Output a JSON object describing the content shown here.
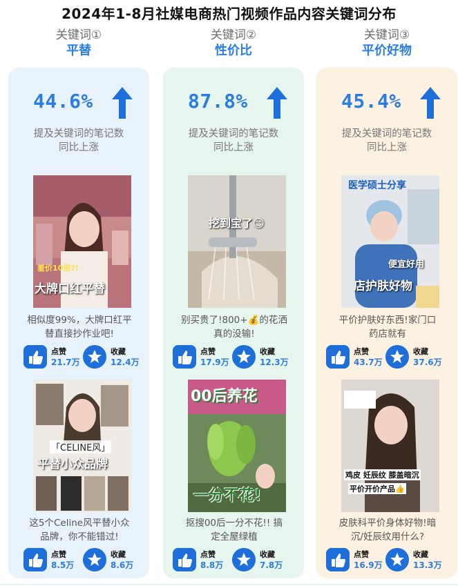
{
  "title": "2024年1-8月社媒电商热门视频作品内容关键词分布",
  "desc_line1": "提及关键词的笔记数",
  "desc_line2": "同比上涨",
  "like_label": "点赞",
  "fav_label": "收藏",
  "columns": [
    {
      "kw_num": "关键词①",
      "kw_name": "平替",
      "pct": "44.6%",
      "posts": [
        {
          "overlay_top": "羞价10倍?!",
          "overlay": "大牌口红平替",
          "caption_1": "相似度99%，大牌口红平",
          "caption_2": "替直接抄作业吧!",
          "likes": "21.7万",
          "favs": "12.4万"
        },
        {
          "overlay_top": "「CELINE风」",
          "overlay": "平替小众品牌",
          "caption_1": "这5个Celine风平替小众",
          "caption_2": "品牌，你不能错过!",
          "likes": "8.5万",
          "favs": "8.6万"
        }
      ]
    },
    {
      "kw_num": "关键词②",
      "kw_name": "性价比",
      "pct": "87.8%",
      "posts": [
        {
          "overlay_top": "",
          "overlay": "挖到宝了😊",
          "caption_1": "别买贵了!800+💰的花洒",
          "caption_2": "真的没输!",
          "likes": "17.9万",
          "favs": "12.3万"
        },
        {
          "overlay_top": "00后养花",
          "overlay": "一分不花!",
          "caption_1": "抠搜00后一分不花!!  搞",
          "caption_2": "定全屋绿植",
          "likes": "8.8万",
          "favs": "7.8万"
        }
      ]
    },
    {
      "kw_num": "关键词③",
      "kw_name": "平价好物",
      "pct": "45.4%",
      "posts": [
        {
          "overlay_top": "医学硕士分享",
          "overlay": "店护肤好物",
          "overlay_mid": "便宜好用",
          "caption_1": "平价护肤好东西!家门口",
          "caption_2": "药店就有",
          "likes": "43.7万",
          "favs": "37.6万"
        },
        {
          "overlay_top": "鸡皮 妊辰纹 膝盖暗沉",
          "overlay": "平价开价产品👍",
          "caption_1": "皮肤科平价身体好物!暗",
          "caption_2": "沉/妊辰纹用什么?",
          "likes": "16.9万",
          "favs": "13.3万"
        }
      ]
    }
  ],
  "colors": {
    "accent": "#2a7de1",
    "icon_bg": "#1e6fd9",
    "card_blue": "#e8f2fb",
    "card_green": "#e6f5ee",
    "card_peach": "#fdf1e2"
  }
}
